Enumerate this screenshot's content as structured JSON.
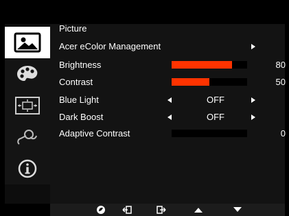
{
  "menu": {
    "title": "Picture",
    "items": [
      {
        "label": "Acer eColor Management",
        "type": "submenu"
      },
      {
        "label": "Brightness",
        "type": "slider",
        "value": "80",
        "level": 0.8
      },
      {
        "label": "Contrast",
        "type": "slider",
        "value": "50",
        "level": 0.5
      },
      {
        "label": "Blue Light",
        "type": "select",
        "value": "OFF"
      },
      {
        "label": "Dark Boost",
        "type": "select",
        "value": "OFF"
      },
      {
        "label": "Adaptive Contrast",
        "type": "slider",
        "value": "0",
        "level": 0
      }
    ]
  },
  "rail": {
    "tabs": [
      {
        "icon": "picture-icon",
        "active": true
      },
      {
        "icon": "palette-icon",
        "active": false
      },
      {
        "icon": "screen-position-icon",
        "active": false
      },
      {
        "icon": "settings-icon",
        "active": false
      },
      {
        "icon": "info-icon",
        "active": false
      }
    ]
  },
  "footer": {
    "buttons": [
      "eco-icon",
      "exit-icon",
      "enter-icon",
      "up-icon",
      "down-icon"
    ]
  },
  "colors": {
    "accent": "#ff3300",
    "panel": "#131313",
    "active_tab": "#ffffff"
  }
}
